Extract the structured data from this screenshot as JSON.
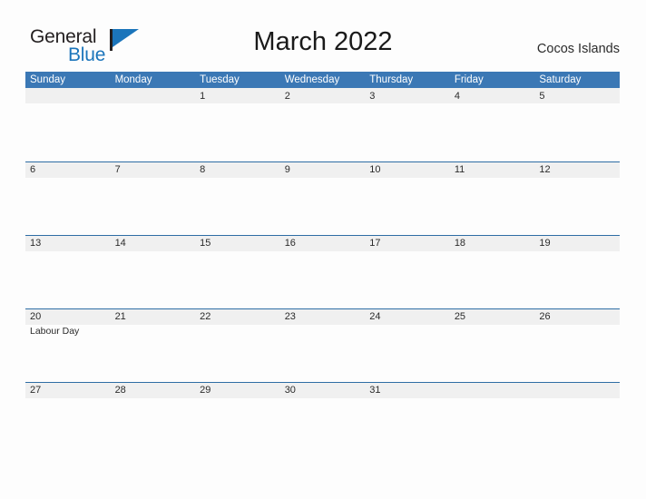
{
  "brand": {
    "word_one": "General",
    "word_two": "Blue",
    "flag_color": "#1b75bb"
  },
  "header": {
    "title": "March 2022",
    "location": "Cocos Islands"
  },
  "calendar": {
    "month": "March",
    "year": "2022",
    "header_color": "#3b78b5",
    "band_color": "#f0f0f0",
    "rule_color": "#2e6da4",
    "weekdays": [
      "Sunday",
      "Monday",
      "Tuesday",
      "Wednesday",
      "Thursday",
      "Friday",
      "Saturday"
    ],
    "weeks": [
      [
        {
          "day": "",
          "events": []
        },
        {
          "day": "",
          "events": []
        },
        {
          "day": "1",
          "events": []
        },
        {
          "day": "2",
          "events": []
        },
        {
          "day": "3",
          "events": []
        },
        {
          "day": "4",
          "events": []
        },
        {
          "day": "5",
          "events": []
        }
      ],
      [
        {
          "day": "6",
          "events": []
        },
        {
          "day": "7",
          "events": []
        },
        {
          "day": "8",
          "events": []
        },
        {
          "day": "9",
          "events": []
        },
        {
          "day": "10",
          "events": []
        },
        {
          "day": "11",
          "events": []
        },
        {
          "day": "12",
          "events": []
        }
      ],
      [
        {
          "day": "13",
          "events": []
        },
        {
          "day": "14",
          "events": []
        },
        {
          "day": "15",
          "events": []
        },
        {
          "day": "16",
          "events": []
        },
        {
          "day": "17",
          "events": []
        },
        {
          "day": "18",
          "events": []
        },
        {
          "day": "19",
          "events": []
        }
      ],
      [
        {
          "day": "20",
          "events": [
            "Labour Day"
          ]
        },
        {
          "day": "21",
          "events": []
        },
        {
          "day": "22",
          "events": []
        },
        {
          "day": "23",
          "events": []
        },
        {
          "day": "24",
          "events": []
        },
        {
          "day": "25",
          "events": []
        },
        {
          "day": "26",
          "events": []
        }
      ],
      [
        {
          "day": "27",
          "events": []
        },
        {
          "day": "28",
          "events": []
        },
        {
          "day": "29",
          "events": []
        },
        {
          "day": "30",
          "events": []
        },
        {
          "day": "31",
          "events": []
        },
        {
          "day": "",
          "events": []
        },
        {
          "day": "",
          "events": []
        }
      ]
    ]
  }
}
